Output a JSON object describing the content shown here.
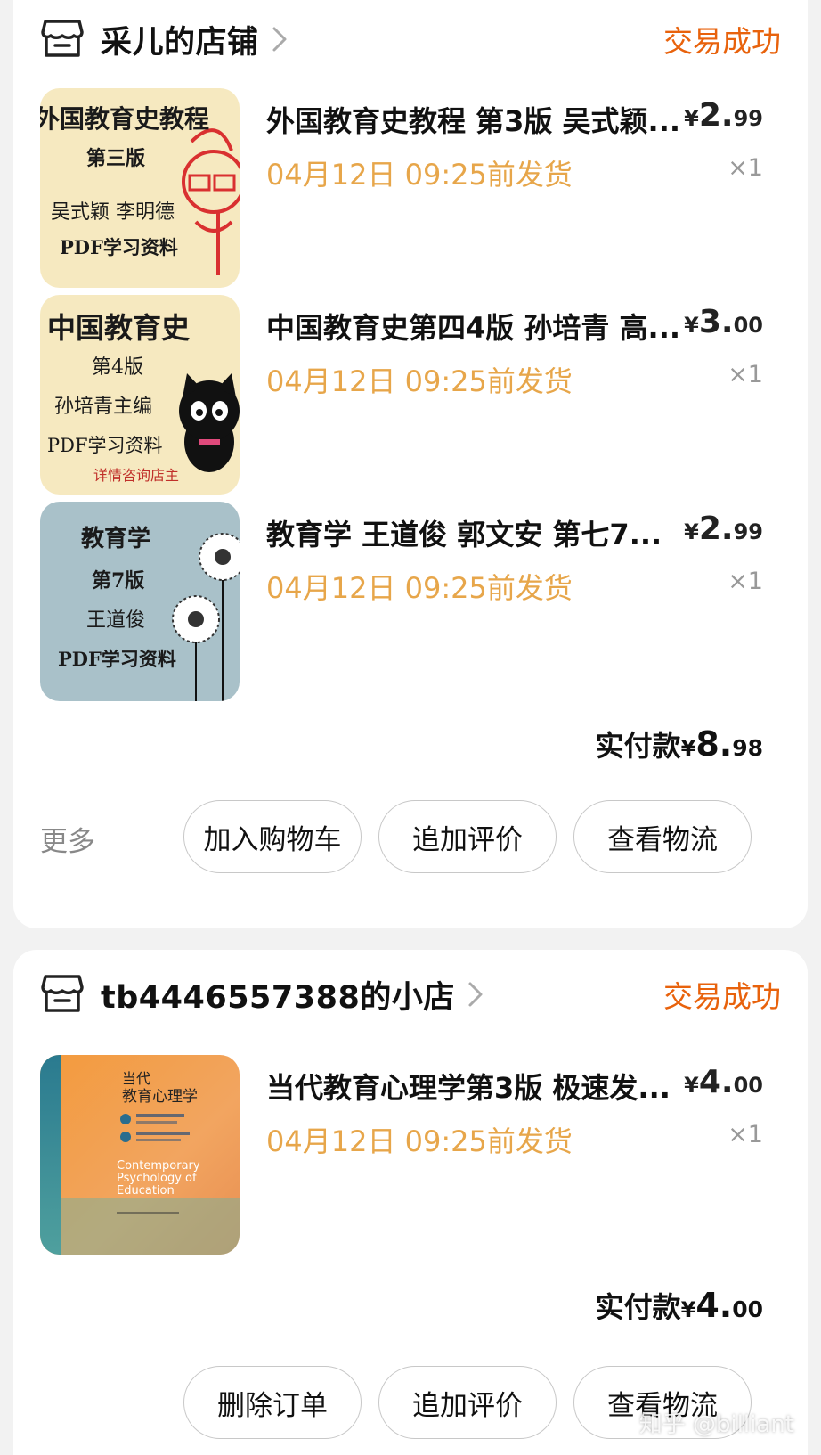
{
  "orders": [
    {
      "shop_name": "采儿的店铺",
      "status": "交易成功",
      "items": [
        {
          "title": "外国教育史教程 第3版 吴式颖...",
          "ship": "04月12日 09:25前发货",
          "price_yen": "¥",
          "price_int": "2.",
          "price_dec": "99",
          "qty": "×1",
          "cover": {
            "lines": [
              "外国教育史教程",
              "第三版",
              "吴式颖  李明德",
              "PDF学习资料"
            ]
          }
        },
        {
          "title": "中国教育史第四4版 孙培青 高...",
          "ship": "04月12日 09:25前发货",
          "price_yen": "¥",
          "price_int": "3.",
          "price_dec": "00",
          "qty": "×1",
          "cover": {
            "lines": [
              "中国教育史",
              "第4版",
              "孙培青主编",
              "PDF学习资料",
              "详情咨询店主"
            ]
          }
        },
        {
          "title": "教育学 王道俊 郭文安 第七7...",
          "ship": "04月12日 09:25前发货",
          "price_yen": "¥",
          "price_int": "2.",
          "price_dec": "99",
          "qty": "×1",
          "cover": {
            "lines": [
              "教育学",
              "第7版",
              "王道俊",
              "PDF学习资料"
            ]
          }
        }
      ],
      "total": {
        "label": "实付款",
        "yen": "¥",
        "int": "8.",
        "dec": "98"
      },
      "more_label": "更多",
      "buttons": [
        "加入购物车",
        "追加评价",
        "查看物流"
      ]
    },
    {
      "shop_name": "tb4446557388的小店",
      "status": "交易成功",
      "items": [
        {
          "title": "当代教育心理学第3版 极速发...",
          "ship": "04月12日 09:25前发货",
          "price_yen": "¥",
          "price_int": "4.",
          "price_dec": "00",
          "qty": "×1",
          "cover": {
            "lines": [
              "当代",
              "教育心理学",
              "Contemporary",
              "Psychology of",
              "Education"
            ]
          }
        }
      ],
      "total": {
        "label": "实付款",
        "yen": "¥",
        "int": "4.",
        "dec": "00"
      },
      "buttons": [
        "删除订单",
        "追加评价",
        "查看物流"
      ]
    }
  ],
  "watermark": "知乎 @billiant",
  "colors": {
    "status": "#e8620c",
    "ship": "#e7a64a",
    "background": "#f2f2f2"
  }
}
